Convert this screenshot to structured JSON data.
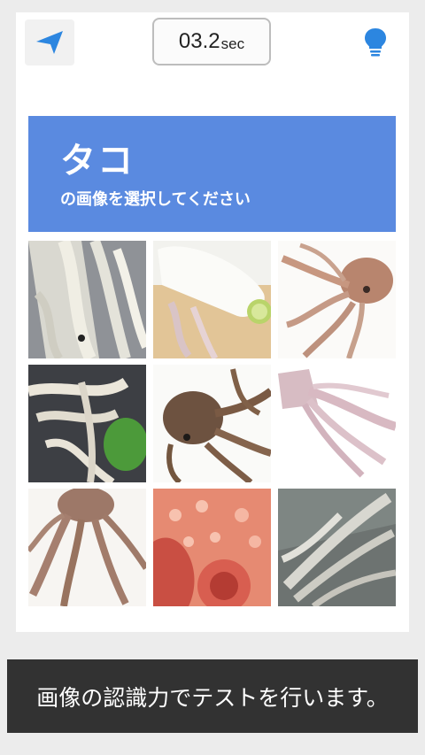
{
  "header": {
    "timer_value": "03.2",
    "timer_unit": "sec"
  },
  "challenge": {
    "target": "タコ",
    "instruction": "の画像を選択してください"
  },
  "grid": {
    "images": [
      {
        "subject": "squid"
      },
      {
        "subject": "squid"
      },
      {
        "subject": "octopus"
      },
      {
        "subject": "squid"
      },
      {
        "subject": "octopus"
      },
      {
        "subject": "squid"
      },
      {
        "subject": "octopus"
      },
      {
        "subject": "octopus"
      },
      {
        "subject": "squid"
      }
    ]
  },
  "footer": {
    "message": "画像の認識力でテストを行います。"
  },
  "colors": {
    "accent": "#5a8ae0",
    "icon_blue": "#2c86e0",
    "footer_bg": "#323232"
  },
  "icons": {
    "back": "arrow-back-icon",
    "hint": "lightbulb-icon"
  }
}
